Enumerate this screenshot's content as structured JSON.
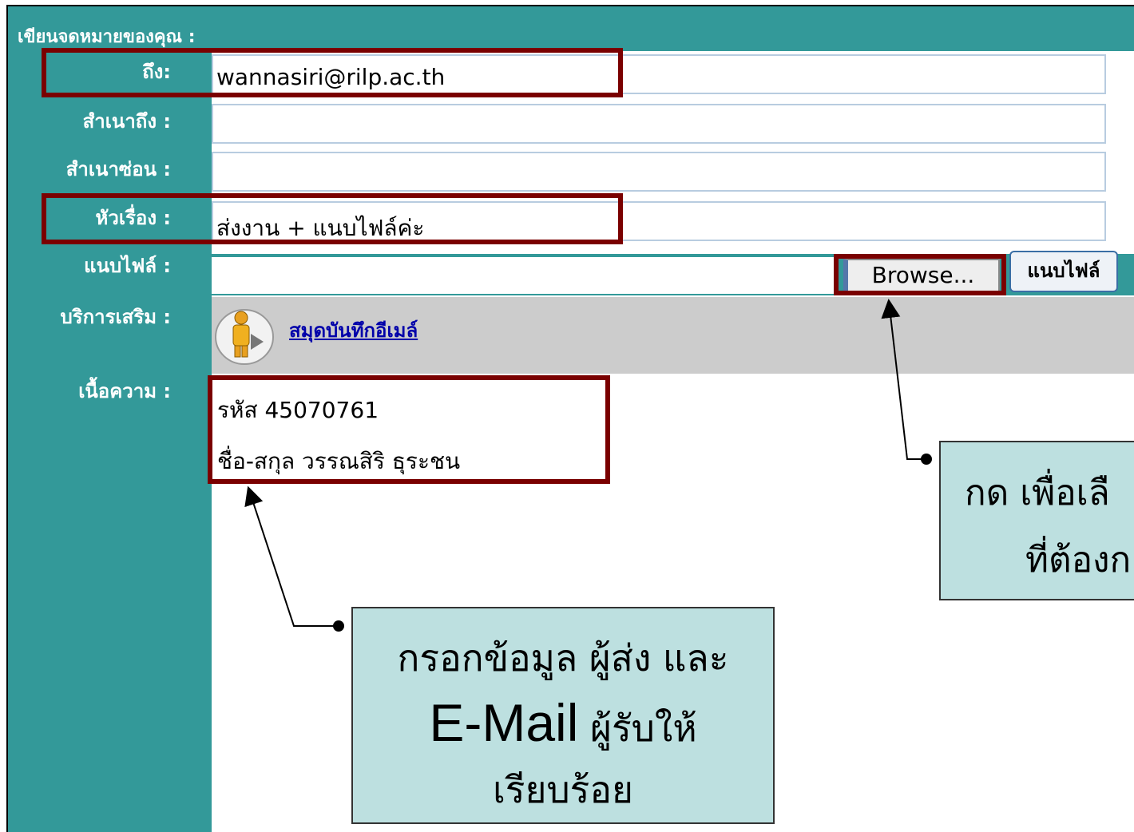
{
  "header": {
    "title": "เขียนจดหมายของคุณ :"
  },
  "fields": {
    "to": {
      "label": "ถึง:",
      "value": "wannasiri@rilp.ac.th"
    },
    "cc": {
      "label": "สำเนาถึง :",
      "value": ""
    },
    "bcc": {
      "label": "สำเนาซ่อน :",
      "value": ""
    },
    "subject": {
      "label": "หัวเรื่อง :",
      "value": "ส่งงาน + แนบไฟล์ค่ะ"
    },
    "attachment": {
      "label": "แนบไฟล์ :",
      "browse_label": "Browse...",
      "attach_label": "แนบไฟล์"
    },
    "services": {
      "label": "บริการเสริม :",
      "addressbook_link": "สมุดบันทึกอีเมล์",
      "icon": "person-icon"
    },
    "body": {
      "label": "เนื้อความ :",
      "lines": [
        "รหัส 45070761",
        "ชื่อ-สกุล วรรณสิริ ธุระชน"
      ]
    }
  },
  "callouts": {
    "fill_info": {
      "line1": "กรอกข้อมูล ผู้ส่ง และ",
      "line2_big": "E-Mail",
      "line2_rest": " ผู้รับให้",
      "line3": "เรียบร้อย"
    },
    "browse_tip": {
      "line1": "กด เพื่อเลื",
      "line2": "ที่ต้องก"
    }
  },
  "colors": {
    "sidebar": "#339999",
    "highlight": "#7a0000",
    "callout": "#bde0e0",
    "service_band": "#cccccc"
  }
}
